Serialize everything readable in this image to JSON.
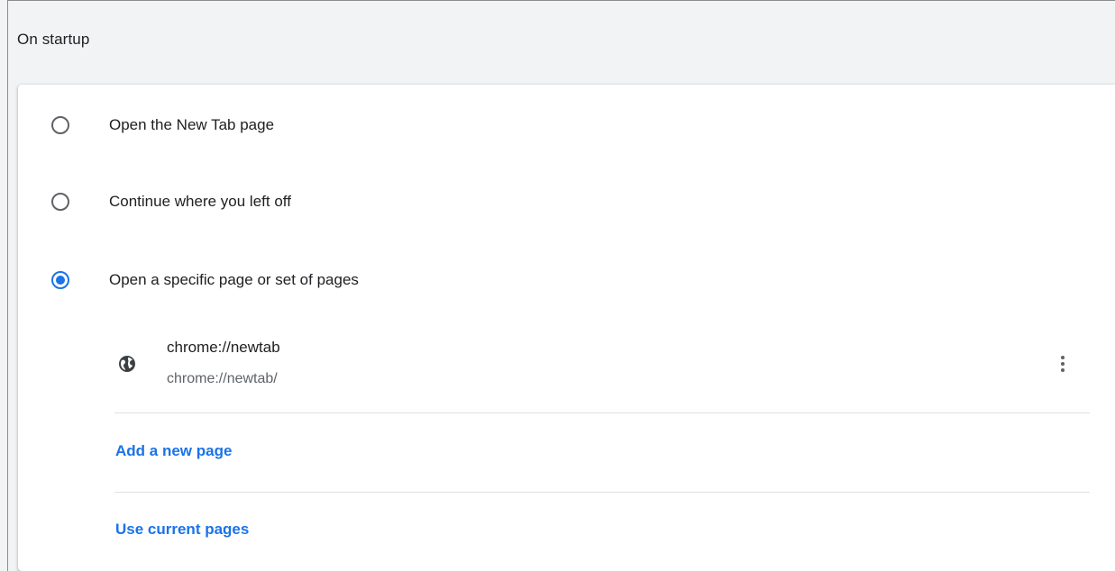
{
  "section": {
    "title": "On startup"
  },
  "options": [
    {
      "label": "Open the New Tab page",
      "checked": false
    },
    {
      "label": "Continue where you left off",
      "checked": false
    },
    {
      "label": "Open a specific page or set of pages",
      "checked": true
    }
  ],
  "pages": [
    {
      "title": "chrome://newtab",
      "url": "chrome://newtab/",
      "icon": "globe-icon",
      "menu_icon": "more-vert-icon"
    }
  ],
  "actions": {
    "add_page": "Add a new page",
    "use_current": "Use current pages"
  },
  "colors": {
    "accent": "#1a73e8",
    "text": "#202124",
    "secondary_text": "#5f6368",
    "background": "#f1f3f4",
    "card": "#ffffff"
  }
}
